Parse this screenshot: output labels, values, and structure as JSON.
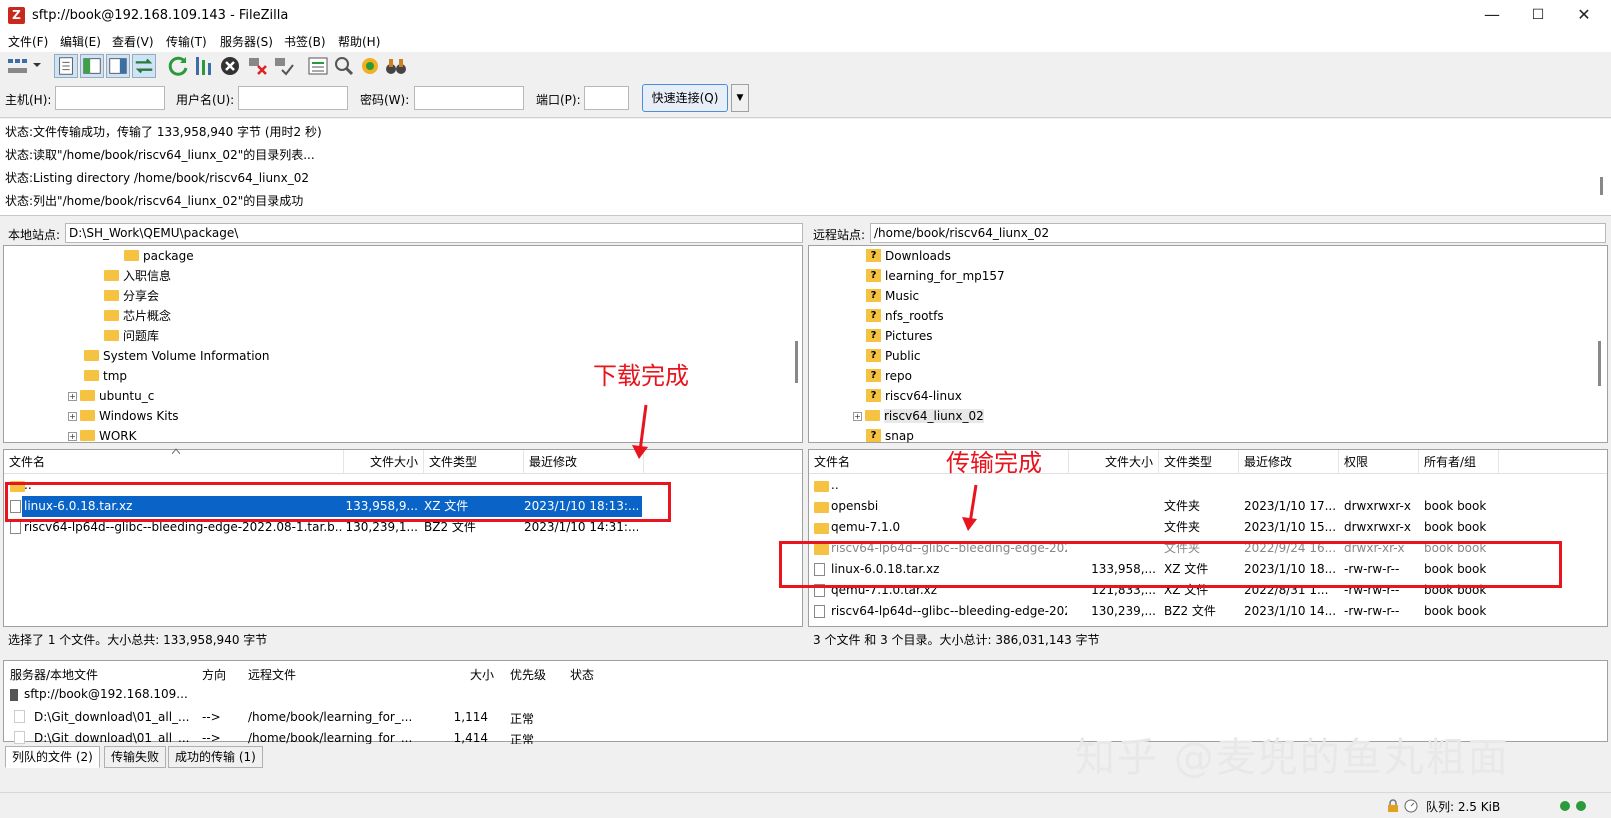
{
  "window": {
    "title": "sftp://book@192.168.109.143 - FileZilla",
    "app_icon": "Z",
    "minimize": "—",
    "maximize": "☐",
    "close": "✕"
  },
  "menu": [
    "文件(F)",
    "编辑(E)",
    "查看(V)",
    "传输(T)",
    "服务器(S)",
    "书签(B)",
    "帮助(H)"
  ],
  "quickconnect": {
    "host_label": "主机(H):",
    "user_label": "用户名(U):",
    "pass_label": "密码(W):",
    "port_label": "端口(P):",
    "button": "快速连接(Q)",
    "dropdown": "▼"
  },
  "log": [
    "状态:文件传输成功，传输了 133,958,940 字节 (用时2 秒)",
    "状态:读取\"/home/book/riscv64_liunx_02\"的目录列表...",
    "状态:Listing directory /home/book/riscv64_liunx_02",
    "状态:列出\"/home/book/riscv64_liunx_02\"的目录成功"
  ],
  "local": {
    "site_label": "本地站点:",
    "path": "D:\\SH_Work\\QEMU\\package\\",
    "tree": [
      {
        "label": "package",
        "expand": ""
      },
      {
        "label": "入职信息",
        "expand": ""
      },
      {
        "label": "分享会",
        "expand": ""
      },
      {
        "label": "芯片概念",
        "expand": ""
      },
      {
        "label": "问题库",
        "expand": ""
      },
      {
        "label": "System Volume Information",
        "expand": ""
      },
      {
        "label": "tmp",
        "expand": ""
      },
      {
        "label": "ubuntu_c",
        "expand": "+"
      },
      {
        "label": "Windows Kits",
        "expand": "+"
      },
      {
        "label": "WORK",
        "expand": "+"
      }
    ],
    "headers": [
      "文件名",
      "文件大小",
      "文件类型",
      "最近修改"
    ],
    "rows": [
      {
        "name": "..",
        "size": "",
        "type": "",
        "modified": ""
      },
      {
        "name": "linux-6.0.18.tar.xz",
        "size": "133,958,9...",
        "type": "XZ 文件",
        "modified": "2023/1/10 18:13:..."
      },
      {
        "name": "riscv64-lp64d--glibc--bleeding-edge-2022.08-1.tar.b...",
        "size": "130,239,1...",
        "type": "BZ2 文件",
        "modified": "2023/1/10 14:31:..."
      }
    ],
    "status": "选择了 1 个文件。大小总共: 133,958,940 字节"
  },
  "remote": {
    "site_label": "远程站点:",
    "path": "/home/book/riscv64_liunx_02",
    "tree": [
      {
        "label": "Downloads",
        "expand": ""
      },
      {
        "label": "learning_for_mp157",
        "expand": ""
      },
      {
        "label": "Music",
        "expand": ""
      },
      {
        "label": "nfs_rootfs",
        "expand": ""
      },
      {
        "label": "Pictures",
        "expand": ""
      },
      {
        "label": "Public",
        "expand": ""
      },
      {
        "label": "repo",
        "expand": ""
      },
      {
        "label": "riscv64-linux",
        "expand": ""
      },
      {
        "label": "riscv64_liunx_02",
        "expand": "+"
      },
      {
        "label": "snap",
        "expand": ""
      }
    ],
    "headers": [
      "文件名",
      "文件大小",
      "文件类型",
      "最近修改",
      "权限",
      "所有者/组"
    ],
    "rows": [
      {
        "name": "..",
        "size": "",
        "type": "",
        "modified": "",
        "perm": "",
        "owner": ""
      },
      {
        "name": "opensbi",
        "size": "",
        "type": "文件夹",
        "modified": "2023/1/10 17...",
        "perm": "drwxrwxr-x",
        "owner": "book book"
      },
      {
        "name": "qemu-7.1.0",
        "size": "",
        "type": "文件夹",
        "modified": "2023/1/10 15...",
        "perm": "drwxrwxr-x",
        "owner": "book book"
      },
      {
        "name": "riscv64-lp64d--glibc--bleeding-edge-2022.08-1",
        "size": "",
        "type": "文件夹",
        "modified": "2022/9/24 16...",
        "perm": "drwxr-xr-x",
        "owner": "book book"
      },
      {
        "name": "linux-6.0.18.tar.xz",
        "size": "133,958,...",
        "type": "XZ 文件",
        "modified": "2023/1/10 18...",
        "perm": "-rw-rw-r--",
        "owner": "book book"
      },
      {
        "name": "qemu-7.1.0.tar.xz",
        "size": "121,833,...",
        "type": "XZ 文件",
        "modified": "2022/8/31 1...",
        "perm": "-rw-rw-r--",
        "owner": "book book"
      },
      {
        "name": "riscv64-lp64d--glibc--bleeding-edge-2022...",
        "size": "130,239,...",
        "type": "BZ2 文件",
        "modified": "2023/1/10 14...",
        "perm": "-rw-rw-r--",
        "owner": "book book"
      }
    ],
    "status": "3 个文件 和 3 个目录。大小总计: 386,031,143 字节"
  },
  "queue": {
    "headers": [
      "服务器/本地文件",
      "方向",
      "远程文件",
      "大小",
      "优先级",
      "状态"
    ],
    "server": "sftp://book@192.168.109...",
    "rows": [
      {
        "local": "D:\\Git_download\\01_all_...",
        "dir": "-->",
        "remote": "/home/book/learning_for_...",
        "size": "1,114",
        "priority": "正常"
      },
      {
        "local": "D:\\Git_download\\01_all_...",
        "dir": "-->",
        "remote": "/home/book/learning_for_...",
        "size": "1,414",
        "priority": "正常"
      }
    ]
  },
  "tabs": [
    "列队的文件 (2)",
    "传输失败",
    "成功的传输 (1)"
  ],
  "statusbar": {
    "queue": "队列: 2.5 KiB"
  },
  "annotations": {
    "download_done": "下载完成",
    "transfer_done": "传输完成"
  },
  "watermark": "知乎 @麦兜的鱼丸粗面",
  "colors": {
    "selection": "#0a64c8",
    "annotation": "#e8141e",
    "folder": "#f5c242"
  }
}
